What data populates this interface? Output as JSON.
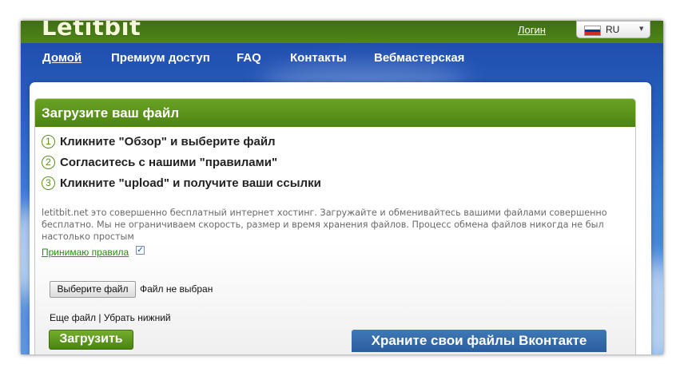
{
  "header": {
    "logo": "Letitbit",
    "login": "Логин",
    "language": "RU",
    "flag_colors": [
      "#ffffff",
      "#0039a6",
      "#d52b1e"
    ]
  },
  "nav": {
    "items": [
      "Домой",
      "Премиум доступ",
      "FAQ",
      "Контакты",
      "Вебмастерская"
    ],
    "active": "Домой"
  },
  "upload": {
    "title": "Загрузите ваш файл",
    "steps": [
      {
        "num": "1",
        "text": "Кликните \"Обзор\" и выберите файл"
      },
      {
        "num": "2",
        "text": "Согласитесь с нашими \"правилами\""
      },
      {
        "num": "3",
        "text": "Кликните \"upload\" и получите ваши ссылки"
      }
    ],
    "description": "letitbit.net это совершенно бесплатный интернет хостинг. Загружайте и обменивайтесь вашими файлами совершенно бесплатно. Мы не ограничиваем скорость, размер и время хранения файлов. Процесс обмена файлов никогда не был настолько простым",
    "rules_label": "Принимаю правила",
    "rules_checked": true,
    "choose_file": "Выберите файл",
    "no_file": "Файл не выбран",
    "more_file": "Еще файл",
    "separator": "|",
    "remove_bottom": "Убрать нижний",
    "upload_button": "Загрузить",
    "vk_button": "Храните свои файлы Вконтакте"
  },
  "colors": {
    "green_dark": "#4c8412",
    "green_light": "#6aa226",
    "sky": "#2a63c4",
    "vk_blue": "#2b5e9c"
  }
}
